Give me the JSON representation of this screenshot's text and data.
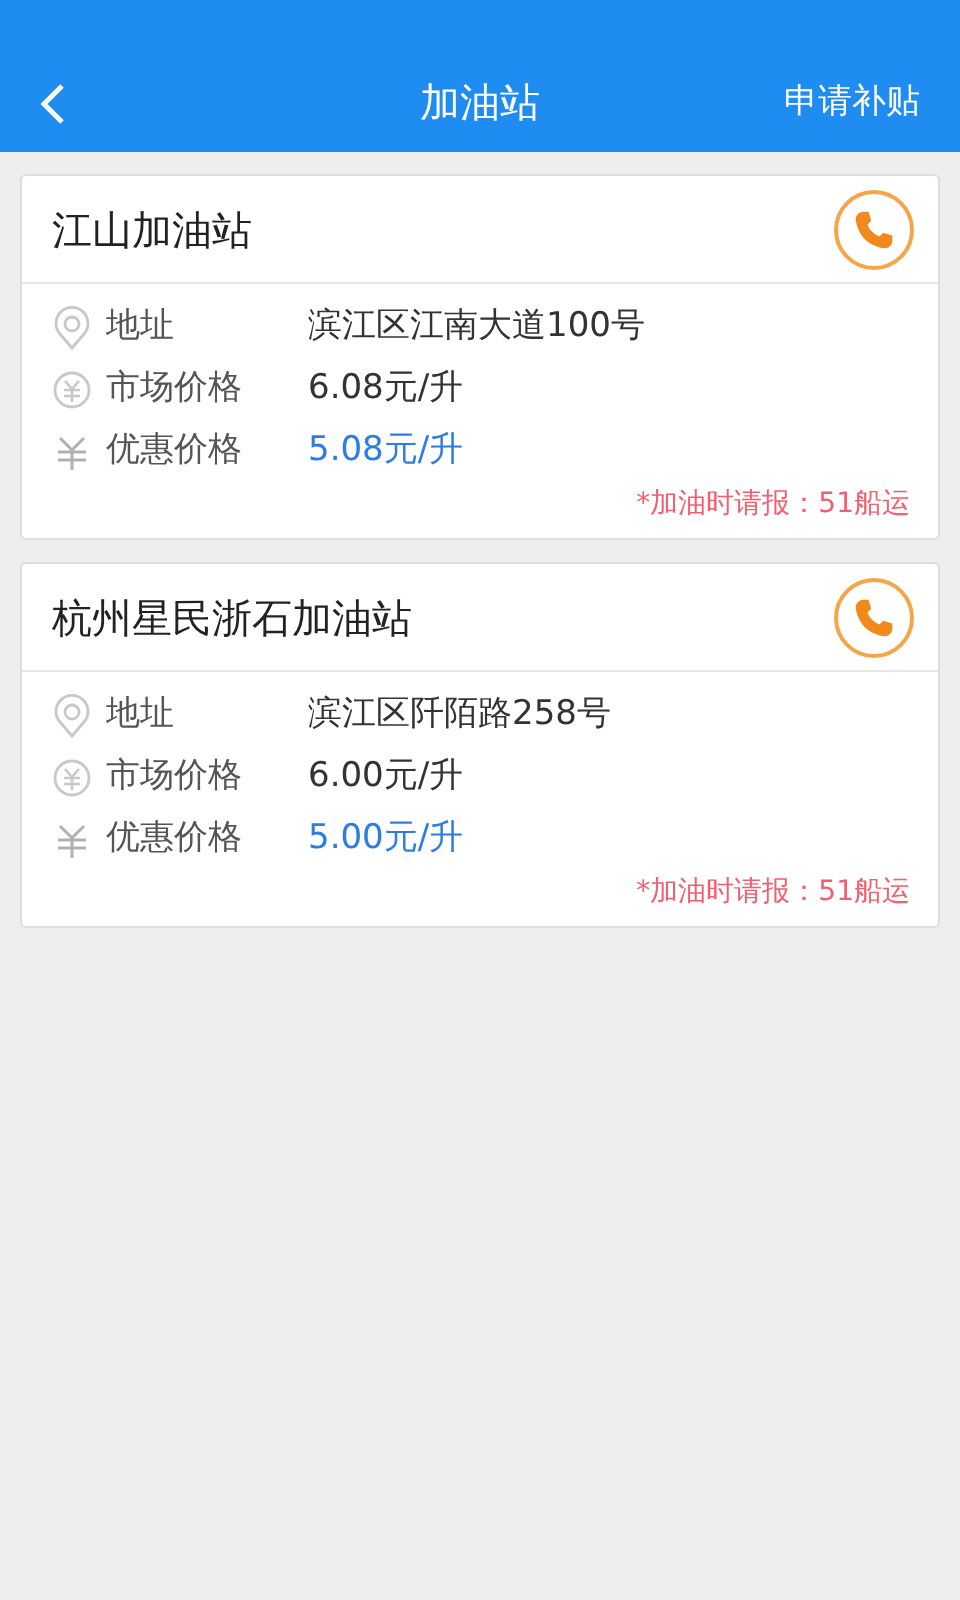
{
  "header": {
    "title": "加油站",
    "action": "申请补贴"
  },
  "stations": [
    {
      "name": "江山加油站",
      "rows": [
        {
          "kind": "address",
          "label": "地址",
          "value": "滨江区江南大道100号"
        },
        {
          "kind": "market",
          "label": "市场价格",
          "value": "6.08元/升"
        },
        {
          "kind": "discount",
          "label": "优惠价格",
          "value": "5.08元/升"
        }
      ],
      "note": "*加油时请报：51船运"
    },
    {
      "name": "杭州星民浙石加油站",
      "rows": [
        {
          "kind": "address",
          "label": "地址",
          "value": "滨江区阡陌路258号"
        },
        {
          "kind": "market",
          "label": "市场价格",
          "value": "6.00元/升"
        },
        {
          "kind": "discount",
          "label": "优惠价格",
          "value": "5.00元/升"
        }
      ],
      "note": "*加油时请报：51船运"
    }
  ]
}
